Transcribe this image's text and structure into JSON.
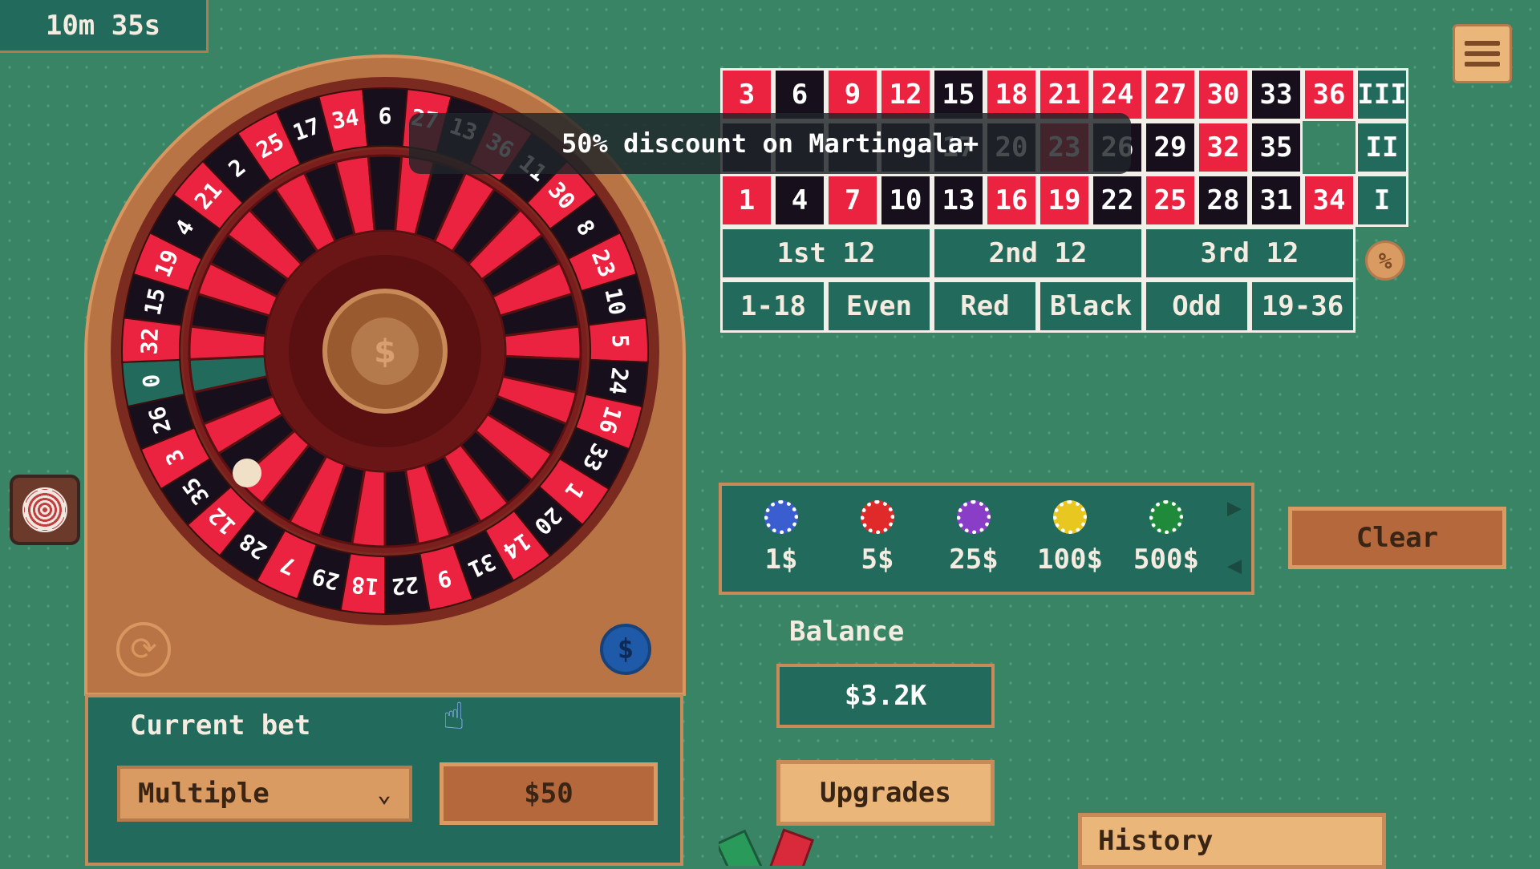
{
  "timer": "10m 35s",
  "discount_banner": "50% discount on Martingala+",
  "board": {
    "rows": [
      [
        {
          "n": "3",
          "c": "red"
        },
        {
          "n": "6",
          "c": "black"
        },
        {
          "n": "9",
          "c": "red"
        },
        {
          "n": "12",
          "c": "red"
        },
        {
          "n": "15",
          "c": "black"
        },
        {
          "n": "18",
          "c": "red"
        },
        {
          "n": "21",
          "c": "red"
        },
        {
          "n": "24",
          "c": "red"
        },
        {
          "n": "27",
          "c": "red"
        },
        {
          "n": "30",
          "c": "red"
        },
        {
          "n": "33",
          "c": "black"
        },
        {
          "n": "36",
          "c": "red"
        }
      ],
      [
        {
          "n": "",
          "c": "black"
        },
        {
          "n": "",
          "c": "black"
        },
        {
          "n": "",
          "c": "black"
        },
        {
          "n": "",
          "c": "black"
        },
        {
          "n": "17",
          "c": "black"
        },
        {
          "n": "20",
          "c": "black"
        },
        {
          "n": "23",
          "c": "red"
        },
        {
          "n": "26",
          "c": "black"
        },
        {
          "n": "29",
          "c": "black"
        },
        {
          "n": "32",
          "c": "red"
        },
        {
          "n": "35",
          "c": "black"
        }
      ],
      [
        {
          "n": "1",
          "c": "red"
        },
        {
          "n": "4",
          "c": "black"
        },
        {
          "n": "7",
          "c": "red"
        },
        {
          "n": "10",
          "c": "black"
        },
        {
          "n": "13",
          "c": "black"
        },
        {
          "n": "16",
          "c": "red"
        },
        {
          "n": "19",
          "c": "red"
        },
        {
          "n": "22",
          "c": "black"
        },
        {
          "n": "25",
          "c": "red"
        },
        {
          "n": "28",
          "c": "black"
        },
        {
          "n": "31",
          "c": "black"
        },
        {
          "n": "34",
          "c": "red"
        }
      ]
    ],
    "columns": [
      "III",
      "II",
      "I"
    ],
    "dozens": [
      "1st 12",
      "2nd 12",
      "3rd 12"
    ],
    "outside": [
      "1-18",
      "Even",
      "Red",
      "Black",
      "Odd",
      "19-36"
    ]
  },
  "wheel_numbers": [
    "0",
    "32",
    "15",
    "19",
    "4",
    "21",
    "2",
    "25",
    "17",
    "34",
    "6",
    "27",
    "13",
    "36",
    "11",
    "30",
    "8",
    "23",
    "10",
    "5",
    "24",
    "16",
    "33",
    "1",
    "20",
    "14",
    "31",
    "9",
    "22",
    "18",
    "29",
    "7",
    "28",
    "12",
    "35",
    "3",
    "26"
  ],
  "chips": [
    {
      "label": "1$",
      "color": "#3a5ed0"
    },
    {
      "label": "5$",
      "color": "#e02a2a"
    },
    {
      "label": "25$",
      "color": "#8a3ec8"
    },
    {
      "label": "100$",
      "color": "#e8c820"
    },
    {
      "label": "500$",
      "color": "#1e8a3a"
    }
  ],
  "clear_label": "Clear",
  "balance_label": "Balance",
  "balance_value": "$3.2K",
  "upgrades_label": "Upgrades",
  "history_label": "History",
  "current_bet": {
    "title": "Current bet",
    "mode": "Multiple",
    "value": "$50"
  },
  "colors": {
    "felt": "#3a8466",
    "panel": "#226a5b",
    "wood": "#b97446",
    "red": "#ec2340",
    "black": "#17101c"
  }
}
